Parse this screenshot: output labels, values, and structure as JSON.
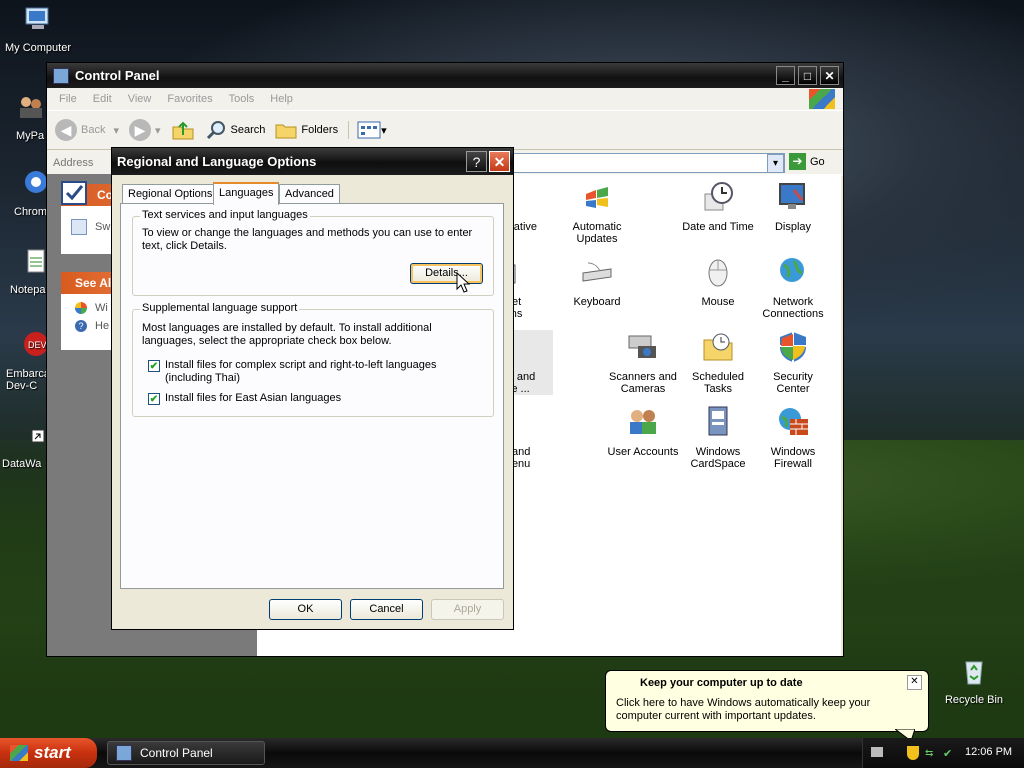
{
  "desktop": {
    "icons": [
      {
        "label": "My Computer"
      },
      {
        "label": "MyPa"
      },
      {
        "label": "Chrom"
      },
      {
        "label": "Notepa"
      },
      {
        "label": "Embarca Dev-C"
      },
      {
        "label": "DataWa"
      },
      {
        "label": "Recycle Bin"
      }
    ]
  },
  "control_panel": {
    "title": "Control Panel",
    "menu": [
      "File",
      "Edit",
      "View",
      "Favorites",
      "Tools",
      "Help"
    ],
    "toolbar": {
      "back": "Back",
      "search": "Search",
      "folders": "Folders"
    },
    "address_label": "Address",
    "go_label": "Go",
    "left_pane": {
      "header1": "Co",
      "item1": "Sw",
      "header2": "See Al",
      "link1": "Wi",
      "link2": "He"
    },
    "items": [
      {
        "label": "Administrative Tools",
        "shown": "nistrative\nools"
      },
      {
        "label": "Automatic Updates",
        "shown": "Automatic\nUpdates"
      },
      {
        "label": "Date and Time",
        "shown": "Date and Time"
      },
      {
        "label": "Display",
        "shown": "Display"
      },
      {
        "label": "Internet Options",
        "shown": "ternet\nptions"
      },
      {
        "label": "Keyboard",
        "shown": "Keyboard"
      },
      {
        "label": "Mouse",
        "shown": "Mouse"
      },
      {
        "label": "Network Connections",
        "shown": "Network\nConnections"
      },
      {
        "label": "Regional and Language Options",
        "shown": "onal and\nuage ..."
      },
      {
        "label": "Scanners and Cameras",
        "shown": "Scanners and\nCameras"
      },
      {
        "label": "Scheduled Tasks",
        "shown": "Scheduled\nTasks"
      },
      {
        "label": "Security Center",
        "shown": "Security\nCenter"
      },
      {
        "label": "Taskbar and Start Menu",
        "shown": "bar and\nrt Menu"
      },
      {
        "label": "User Accounts",
        "shown": "User Accounts"
      },
      {
        "label": "Windows CardSpace",
        "shown": "Windows\nCardSpace"
      },
      {
        "label": "Windows Firewall",
        "shown": "Windows\nFirewall"
      }
    ]
  },
  "dialog": {
    "title": "Regional and Language Options",
    "tabs": [
      "Regional Options",
      "Languages",
      "Advanced"
    ],
    "active_tab": "Languages",
    "group1": {
      "title": "Text services and input languages",
      "text": "To view or change the languages and methods you can use to enter text, click Details.",
      "details_button": "Details..."
    },
    "group2": {
      "title": "Supplemental language support",
      "text": "Most languages are installed by default. To install additional languages, select the appropriate check box below.",
      "check1": "Install files for complex script and right-to-left languages (including Thai)",
      "check2": "Install files for East Asian languages",
      "check1_checked": true,
      "check2_checked": true
    },
    "buttons": {
      "ok": "OK",
      "cancel": "Cancel",
      "apply": "Apply"
    }
  },
  "balloon": {
    "title": "Keep your computer up to date",
    "text": "Click here to have Windows automatically keep your computer current with important updates."
  },
  "taskbar": {
    "start": "start",
    "task": "Control Panel",
    "clock": "12:06 PM"
  }
}
